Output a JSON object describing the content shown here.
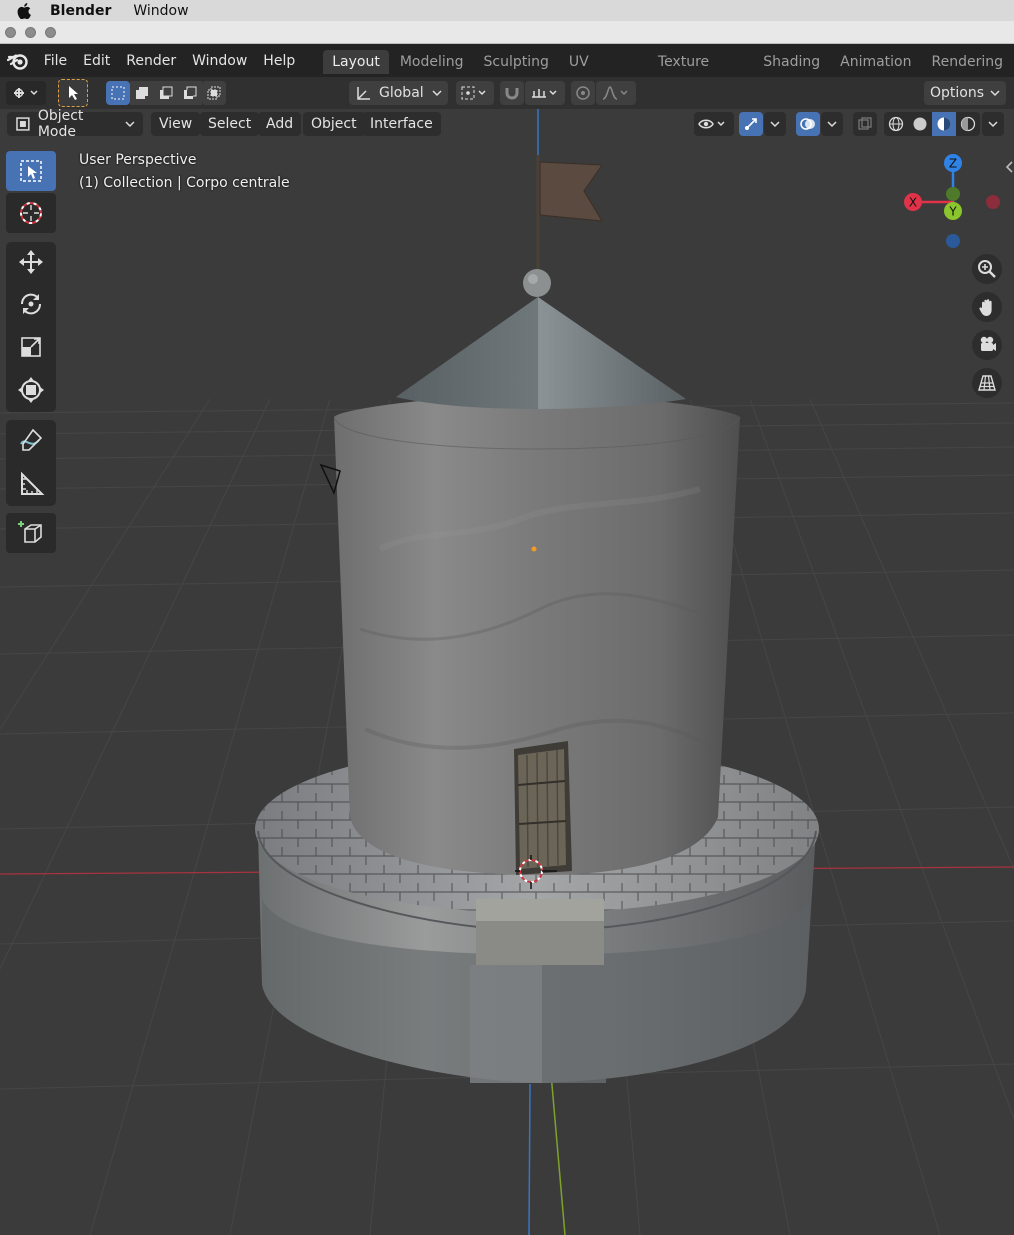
{
  "os_menubar": {
    "app_name": "Blender",
    "window_menu": "Window"
  },
  "top_menu": [
    "File",
    "Edit",
    "Render",
    "Window",
    "Help"
  ],
  "workspace_tabs": [
    "Layout",
    "Modeling",
    "Sculpting",
    "UV Editing",
    "Texture Paint",
    "Shading",
    "Animation",
    "Rendering"
  ],
  "active_workspace": "Layout",
  "toolbar": {
    "transform_orientation": "Global",
    "options_label": "Options"
  },
  "viewport_header": {
    "mode": "Object Mode",
    "menus": [
      "View",
      "Select",
      "Add",
      "Object",
      "Interface"
    ]
  },
  "viewport_overlay": {
    "view_name": "User Perspective",
    "collection_info": "(1) Collection | Corpo centrale"
  },
  "gizmo_axes": {
    "x": "X",
    "y": "Y",
    "z": "Z"
  },
  "icons": {
    "left_tools": [
      "select-box-icon",
      "cursor-icon",
      "move-icon",
      "rotate-icon",
      "scale-icon",
      "transform-icon",
      "annotate-icon",
      "measure-icon",
      "add-cube-icon"
    ],
    "nav": [
      "zoom-icon",
      "hand-pan-icon",
      "camera-icon",
      "grid-perspective-icon"
    ]
  },
  "colors": {
    "accent": "#4772b3",
    "axis_x": "#e0334a",
    "axis_y": "#8ac52e",
    "axis_z": "#2f83e6",
    "grid_line": "#464646",
    "background": "#3b3b3b"
  }
}
